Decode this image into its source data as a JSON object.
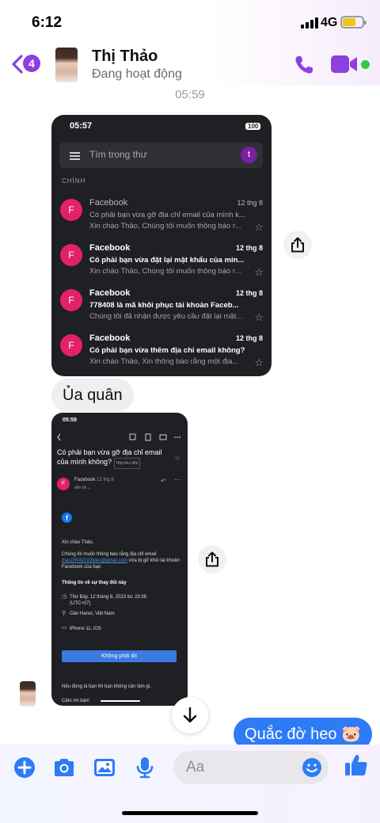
{
  "status_bar": {
    "time": "6:12",
    "network": "4G"
  },
  "header": {
    "back_badge_count": "4",
    "contact_name": "Thị Thảo",
    "contact_status": "Đang hoạt động",
    "accent_color": "#8f3fe0"
  },
  "conversation": {
    "timestamp": "05:59",
    "incoming_text": "Ủa quân",
    "outgoing_text": "Quắc đờ heo 🐷"
  },
  "shared_image_1": {
    "time": "05:57",
    "battery": "100",
    "search_placeholder": "Tìm trong thư",
    "account_initial": "t",
    "section_label": "CHÍNH",
    "emails": [
      {
        "avatar": "F",
        "sender": "Facebook",
        "date": "12 thg 8",
        "subject": "Có phải bạn vừa gỡ địa chỉ email của mình k...",
        "snippet": "Xin chào Thảo, Chúng tôi muốn thông báo r...",
        "unread": false
      },
      {
        "avatar": "F",
        "sender": "Facebook",
        "date": "12 thg 8",
        "subject": "Có phải bạn vừa đặt lại mật khẩu của min...",
        "snippet": "Xin chào Thảo, Chúng tôi muốn thông báo r...",
        "unread": true
      },
      {
        "avatar": "F",
        "sender": "Facebook",
        "date": "12 thg 8",
        "subject": "778408 là mã khôi phục tài khoản Faceb...",
        "snippet": "Chúng tôi đã nhận được yêu cầu đặt lại mật...",
        "unread": true
      },
      {
        "avatar": "F",
        "sender": "Facebook",
        "date": "12 thg 8",
        "subject": "Có phải bạn vừa thêm địa chỉ email không?",
        "snippet": "Xin chào Thảo, Xin thông báo rằng một địa...",
        "unread": true
      }
    ]
  },
  "shared_image_2": {
    "time": "05:59",
    "title": "Có phải bạn vừa gỡ địa chỉ email của mình không?",
    "folder": "Hộp thư đến",
    "sender": "Facebook",
    "sender_date": "12 thg 8",
    "to_line": "đến tôi ⌄",
    "fb_logo": "f",
    "greeting": "Xin chào Thảo,",
    "body_1": "Chúng tôi muốn thông báo rằng địa chỉ email",
    "email_link": "thao23042022kieu@gmail.com",
    "body_2": "vừa bị gỡ khỏi tài khoản Facebook của bạn.",
    "info_heading": "Thông tin về sự thay đổi này",
    "info_date": "Thứ Bảy, 12 tháng 8, 2023 lúc 23:38 (UTC+07)",
    "info_location": "Gần Hanoi, Việt Nam",
    "info_device": "iPhone 11, iOS",
    "button_label": "Không phải tôi",
    "footer_1": "Nếu đúng là bạn thì bạn không cần làm gì.",
    "footer_2": "Cảm ơn bạn!"
  },
  "composer": {
    "placeholder": "Aa",
    "accent_color": "#2e7bf6"
  }
}
